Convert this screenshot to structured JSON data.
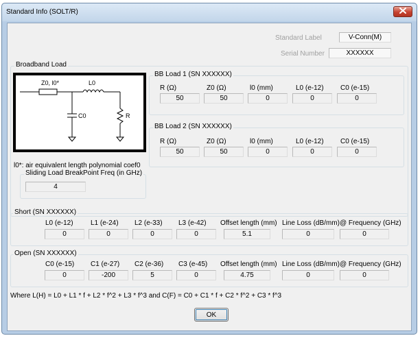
{
  "window": {
    "title": "Standard Info (SOLT/R)"
  },
  "header": {
    "standard_label_caption": "Standard Label",
    "standard_label_value": "V-Conn(M)",
    "serial_number_caption": "Serial Number",
    "serial_number_value": "XXXXXX"
  },
  "broadband": {
    "group_label": "Broadband Load",
    "schematic": {
      "z0_label": "Z0, l0*",
      "l0_label": "L0",
      "c0_label": "C0",
      "r_label": "R"
    },
    "footnote": "l0*: air equivalent length polynomial coef0",
    "bb1": {
      "label": "BB Load 1 (SN XXXXXX)",
      "headers": [
        "R (Ω)",
        "Z0 (Ω)",
        "l0 (mm)",
        "L0 (e-12)",
        "C0 (e-15)"
      ],
      "values": [
        "50",
        "50",
        "0",
        "0",
        "0"
      ]
    },
    "bb2": {
      "label": "BB Load 2 (SN XXXXXX)",
      "headers": [
        "R (Ω)",
        "Z0 (Ω)",
        "l0 (mm)",
        "L0 (e-12)",
        "C0 (e-15)"
      ],
      "values": [
        "50",
        "50",
        "0",
        "0",
        "0"
      ]
    },
    "sliding": {
      "label": "Sliding Load BreakPoint Freq (in GHz)",
      "value": "4"
    }
  },
  "short": {
    "label": "Short (SN XXXXXX)",
    "headers": [
      "L0 (e-12)",
      "L1 (e-24)",
      "L2 (e-33)",
      "L3 (e-42)",
      "Offset length (mm)",
      "Line Loss (dB/mm)",
      "@ Frequency (GHz)"
    ],
    "values": [
      "0",
      "0",
      "0",
      "0",
      "5.1",
      "0",
      "0"
    ]
  },
  "open": {
    "label": "Open (SN XXXXXX)",
    "headers": [
      "C0 (e-15)",
      "C1 (e-27)",
      "C2 (e-36)",
      "C3 (e-45)",
      "Offset length (mm)",
      "Line Loss (dB/mm)",
      "@ Frequency (GHz)"
    ],
    "values": [
      "0",
      "-200",
      "5",
      "0",
      "4.75",
      "0",
      "0"
    ]
  },
  "formula": "Where L(H) = L0 + L1 * f + L2 * f^2 + L3 * f^3  and  C(F) = C0 + C1 * f + C2 * f^2 + C3 * f^3",
  "buttons": {
    "ok_label": "OK"
  },
  "icons": {
    "close": "close-icon"
  },
  "colors": {
    "close_button": "#c74331",
    "title_bar": "#c3d6ea",
    "dialog_bg": "#f0f0f0"
  }
}
